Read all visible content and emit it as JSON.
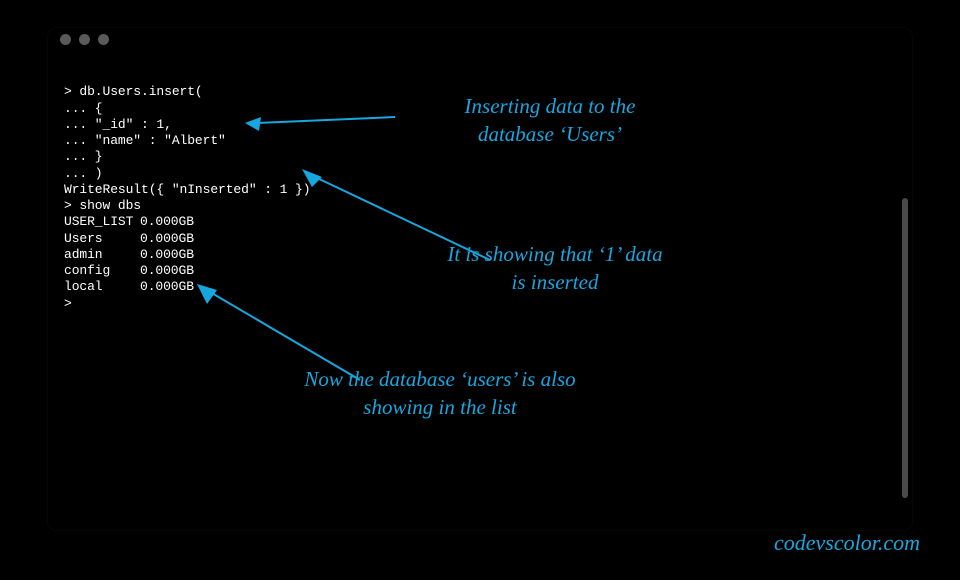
{
  "terminal": {
    "lines": [
      "> db.Users.insert(",
      "... {",
      "... \"_id\" : 1,",
      "... \"name\" : \"Albert\"",
      "... }",
      "... )",
      "WriteResult({ \"nInserted\" : 1 })",
      "> show dbs"
    ],
    "dbs": [
      {
        "name": "USER_LIST",
        "size": "0.000GB"
      },
      {
        "name": "Users",
        "size": "0.000GB"
      },
      {
        "name": "admin",
        "size": "0.000GB"
      },
      {
        "name": "config",
        "size": "0.000GB"
      },
      {
        "name": "local",
        "size": "0.000GB"
      }
    ],
    "final_prompt": ">"
  },
  "annotations": {
    "a1_line1": "Inserting data to the",
    "a1_line2": "database ‘Users’",
    "a2_line1": "It is showing that ‘1’ data",
    "a2_line2": "is inserted",
    "a3_line1": "Now the database ‘users’ is also",
    "a3_line2": "showing in the list"
  },
  "watermark": "codevscolor.com"
}
